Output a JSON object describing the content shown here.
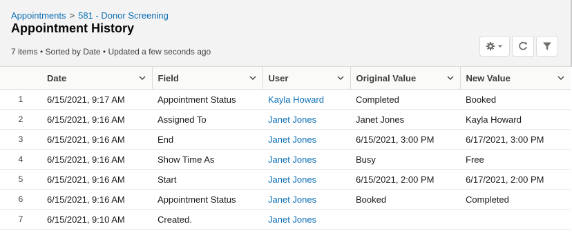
{
  "breadcrumb": {
    "parent": "Appointments",
    "separator": ">",
    "record": "581 - Donor Screening"
  },
  "title": "Appointment History",
  "meta": "7 items • Sorted by Date • Updated a few seconds ago",
  "toolbar": {
    "settings_icon": "gear-icon",
    "refresh_icon": "refresh-icon",
    "filter_icon": "filter-icon"
  },
  "columns": [
    "Date",
    "Field",
    "User",
    "Original Value",
    "New Value"
  ],
  "rows": [
    {
      "num": "1",
      "date": "6/15/2021, 9:17 AM",
      "field": "Appointment Status",
      "user": "Kayla Howard",
      "original": "Completed",
      "new": "Booked"
    },
    {
      "num": "2",
      "date": "6/15/2021, 9:16 AM",
      "field": "Assigned To",
      "user": "Janet Jones",
      "original": "Janet Jones",
      "new": "Kayla Howard"
    },
    {
      "num": "3",
      "date": "6/15/2021, 9:16 AM",
      "field": "End",
      "user": "Janet Jones",
      "original": "6/15/2021, 3:00 PM",
      "new": "6/17/2021, 3:00 PM"
    },
    {
      "num": "4",
      "date": "6/15/2021, 9:16 AM",
      "field": "Show Time As",
      "user": "Janet Jones",
      "original": "Busy",
      "new": "Free"
    },
    {
      "num": "5",
      "date": "6/15/2021, 9:16 AM",
      "field": "Start",
      "user": "Janet Jones",
      "original": "6/15/2021, 2:00 PM",
      "new": "6/17/2021, 2:00 PM"
    },
    {
      "num": "6",
      "date": "6/15/2021, 9:16 AM",
      "field": "Appointment Status",
      "user": "Janet Jones",
      "original": "Booked",
      "new": "Completed"
    },
    {
      "num": "7",
      "date": "6/15/2021, 9:10 AM",
      "field": "Created.",
      "user": "Janet Jones",
      "original": "",
      "new": ""
    }
  ],
  "colors": {
    "link": "#0b6fb6",
    "header_bg": "#f3f3f3",
    "border": "#dddbda"
  }
}
